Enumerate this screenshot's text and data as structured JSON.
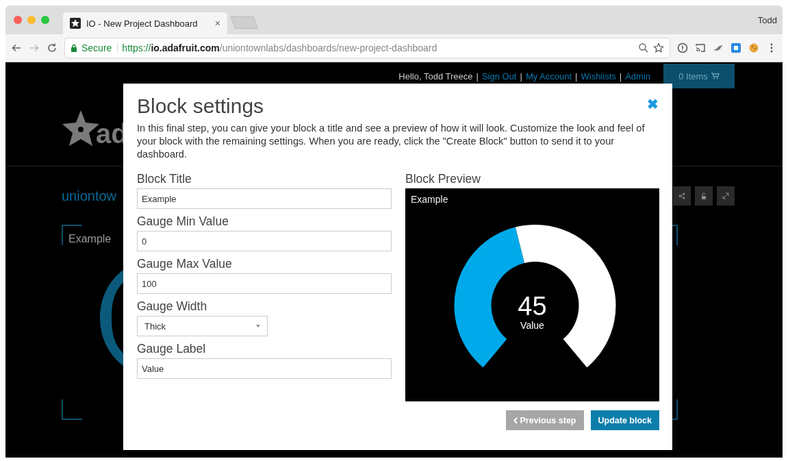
{
  "browser": {
    "tab_title": "IO - New Project Dashboard",
    "tab_close": "×",
    "profile": "Todd",
    "secure_label": "Secure",
    "url_scheme": "https://",
    "url_host": "io.adafruit.com",
    "url_path": "/uniontownlabs/dashboards/new-project-dashboard"
  },
  "site_header": {
    "items": [
      {
        "text": "Hello, Todd Treece",
        "kind": "greeting"
      },
      {
        "text": "|",
        "kind": "separator"
      },
      {
        "text": "Sign Out",
        "kind": "link"
      },
      {
        "text": "|",
        "kind": "separator"
      },
      {
        "text": "My Account",
        "kind": "link"
      },
      {
        "text": "|",
        "kind": "separator"
      },
      {
        "text": "Wishlists",
        "kind": "link"
      },
      {
        "text": "|",
        "kind": "separator"
      },
      {
        "text": "Admin",
        "kind": "link"
      }
    ],
    "cart": "0 Items"
  },
  "logo_text": "ad",
  "breadcrumb": "uniontow",
  "background_block": {
    "title": "Example"
  },
  "modal": {
    "title": "Block settings",
    "close": "✖",
    "description": "In this final step, you can give your block a title and see a preview of how it will look. Customize the look and feel of your block with the remaining settings. When you are ready, click the \"Create Block\" button to send it to your dashboard.",
    "fields": [
      {
        "label": "Block Title",
        "value": "Example",
        "kind": "text"
      },
      {
        "label": "Gauge Min Value",
        "value": "0",
        "kind": "text"
      },
      {
        "label": "Gauge Max Value",
        "value": "100",
        "kind": "text"
      },
      {
        "label": "Gauge Width",
        "value": "Thick",
        "kind": "select"
      },
      {
        "label": "Gauge Label",
        "value": "Value",
        "kind": "text"
      }
    ],
    "preview": {
      "heading": "Block Preview",
      "title": "Example",
      "value": "45",
      "label": "Value"
    },
    "buttons": [
      {
        "label": "Previous step",
        "kind": "secondary"
      },
      {
        "label": "Update block",
        "kind": "primary"
      }
    ]
  }
}
